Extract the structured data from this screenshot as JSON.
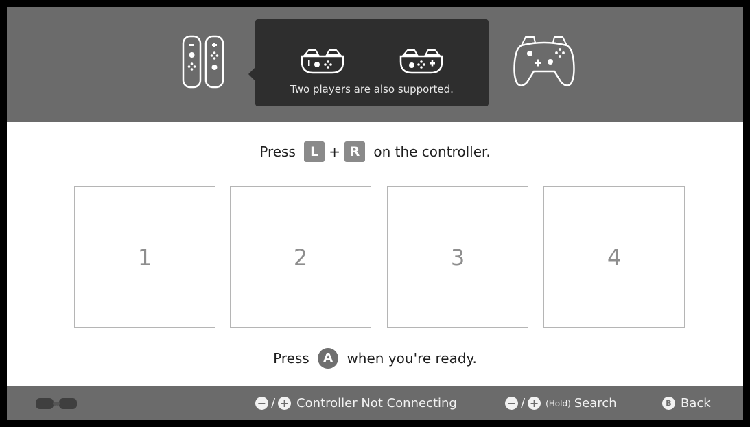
{
  "header": {
    "tooltip_text": "Two players are also supported.",
    "icons": [
      "joycon-pair-icon",
      "joycon-sideways-left-icon",
      "joycon-sideways-right-icon",
      "pro-controller-icon"
    ]
  },
  "instruction": {
    "prefix": "Press",
    "key_l": "L",
    "plus": "+",
    "key_r": "R",
    "suffix": "on the controller."
  },
  "slots": [
    "1",
    "2",
    "3",
    "4"
  ],
  "ready": {
    "prefix": "Press",
    "key_a": "A",
    "suffix": "when you're ready."
  },
  "footer": {
    "not_connecting": {
      "minus": "−",
      "slash": "/",
      "plus": "+",
      "label": "Controller Not Connecting"
    },
    "search": {
      "minus": "−",
      "slash": "/",
      "plus": "+",
      "hold": "(Hold)",
      "label": "Search"
    },
    "back": {
      "key": "B",
      "label": "Back"
    }
  },
  "colors": {
    "header_bg": "#6b6b6b",
    "tooltip_bg": "#2e2e2e",
    "key_bg": "#8a8a8a",
    "slot_border": "#b5b5b5"
  }
}
